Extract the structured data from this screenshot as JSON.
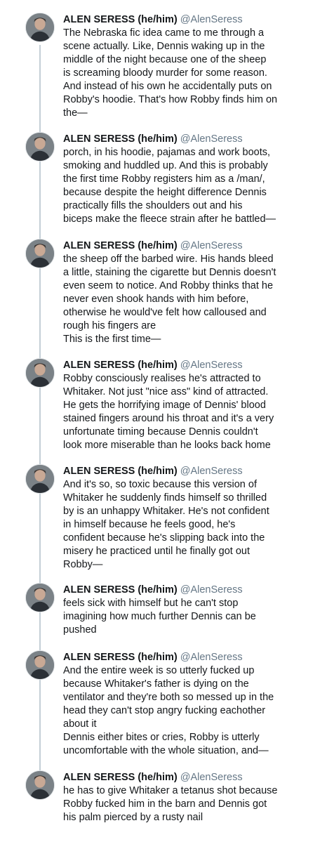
{
  "author": {
    "name": "ALEN SERESS (he/him)",
    "handle": "@AlenSeress"
  },
  "tweets": [
    {
      "text": "The Nebraska fic idea came to me through a\nscene actually. Like, Dennis waking up in the\nmiddle of the night because one of the sheep\nis screaming bloody murder for some reason.\nAnd instead of his own he accidentally puts on\nRobby's hoodie. That's how Robby finds him on\nthe—"
    },
    {
      "text": "porch, in his hoodie, pajamas and work boots,\nsmoking and huddled up. And this is probably\nthe first time Robby registers him as a /man/,\nbecause despite the height difference Dennis\npractically fills the shoulders out and his\nbiceps make the fleece strain after he battled—"
    },
    {
      "text": "the sheep off the barbed wire. His hands bleed\na little, staining the cigarette but Dennis doesn't\neven seem to notice. And Robby thinks that he\nnever even shook hands with him before,\notherwise he would've felt how calloused and\nrough his fingers are\nThis is the first time—"
    },
    {
      "text": "Robby consciously realises he's attracted to\nWhitaker. Not just \"nice ass\" kind of attracted.\nHe gets the horrifying image of Dennis' blood\nstained fingers around his throat and it's a very\nunfortunate timing because Dennis couldn't\nlook more miserable than he looks back home"
    },
    {
      "text": "And it's so, so toxic because this version of\nWhitaker he suddenly finds himself so thrilled\nby is an unhappy Whitaker. He's not confident\nin himself because he feels good, he's\nconfident because he's slipping back into the\nmisery he practiced until he finally got out\nRobby—"
    },
    {
      "text": "feels sick with himself but he can't stop\nimagining how much further Dennis can be\npushed"
    },
    {
      "text": "And the entire week is so utterly fucked up\nbecause Whitaker's father is dying on the\nventilator and they're both so messed up in the\nhead they can't stop angry fucking eachother\nabout it\nDennis either bites or cries, Robby is utterly\nuncomfortable with the whole situation, and—"
    },
    {
      "text": "he has to give Whitaker a tetanus shot because\nRobby fucked him in the barn and Dennis got\nhis palm pierced by a rusty nail"
    }
  ]
}
